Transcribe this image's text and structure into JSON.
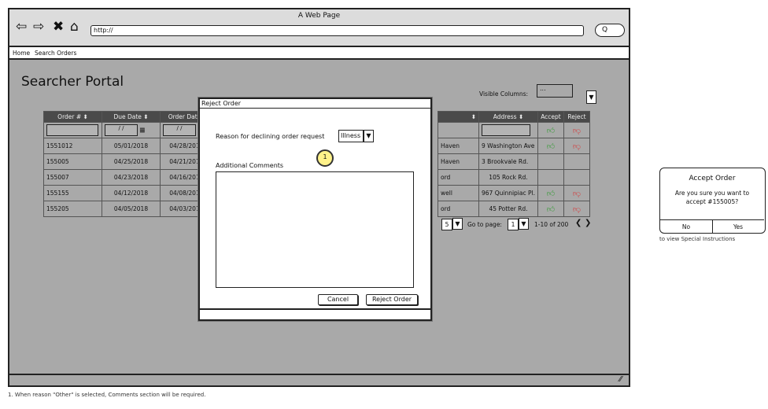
{
  "window_title": "A Web Page",
  "url": "http://",
  "search_button": "Q",
  "menu": {
    "home": "Home",
    "search_orders": "Search Orders"
  },
  "page_title": "Searcher Portal",
  "visible_columns_label": "Visible Columns:",
  "visible_columns_value": "...",
  "table": {
    "headers": [
      "Order #",
      "Due Date",
      "Order Date",
      "Address",
      "Accept",
      "Reject"
    ],
    "date_placeholder": "/ /",
    "rows": [
      {
        "order": "1551012",
        "due": "05/01/2018",
        "order_date": "04/28/201",
        "town": "Haven",
        "address": "9 Washington Ave",
        "accept": true,
        "reject": true
      },
      {
        "order": "155005",
        "due": "04/25/2018",
        "order_date": "04/21/201",
        "town": "Haven",
        "address": "3 Brookvale Rd.",
        "accept": false,
        "reject": false
      },
      {
        "order": "155007",
        "due": "04/23/2018",
        "order_date": "04/16/201",
        "town": "ord",
        "address": "105 Rock Rd.",
        "accept": false,
        "reject": false
      },
      {
        "order": "155155",
        "due": "04/12/2018",
        "order_date": "04/08/201",
        "town": "well",
        "address": "967 Quinnipiac Pl.",
        "accept": true,
        "reject": true
      },
      {
        "order": "155205",
        "due": "04/05/2018",
        "order_date": "04/03/201",
        "town": "ord",
        "address": "45 Potter Rd.",
        "accept": true,
        "reject": true
      }
    ]
  },
  "pager": {
    "per_page": "5",
    "goto_label": "Go to page:",
    "page": "1",
    "range": "1-10 of 200",
    "prev": "❮",
    "next": "❯"
  },
  "modal": {
    "title": "Reject Order",
    "reason_label": "Reason for declining order request",
    "reason_value": "Illness",
    "comments_label": "Additional Comments",
    "cancel": "Cancel",
    "reject": "Reject Order"
  },
  "callout_number": "1",
  "accept_dialog": {
    "title": "Accept Order",
    "message": "Are you sure you want to accept #155005?",
    "no": "No",
    "yes": "Yes",
    "behind_text": "to view Special Instructions"
  },
  "footnote": "1. When reason \"Other\" is selected, Comments section will be required.",
  "colors": {
    "chrome": "#dcdcdc",
    "overlay": "#a9a9a9",
    "callout": "#fff28a",
    "accept": "#3c9c3c",
    "reject": "#d14545"
  }
}
